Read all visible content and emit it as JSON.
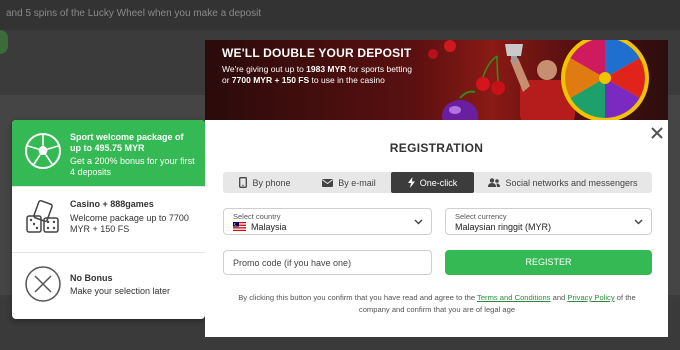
{
  "background": {
    "top_text": "and 5 spins of the Lucky Wheel when you make a deposit"
  },
  "banner": {
    "title": "WE'LL DOUBLE YOUR DEPOSIT",
    "line1_pre": "We're giving out up to ",
    "line1_amount": "1983 MYR",
    "line1_post": " for sports betting",
    "line2_pre": "or ",
    "line2_amount": "7700 MYR + 150 FS",
    "line2_post": " to use in the casino"
  },
  "bonuses": [
    {
      "title": "Sport welcome package of up to 495.75 MYR",
      "desc": "Get a 200% bonus for your first 4 deposits",
      "icon": "football-icon",
      "selected": true
    },
    {
      "title": "Casino + 888games",
      "desc": "Welcome package up to 7700 MYR + 150 FS",
      "icon": "casino-dice-icon",
      "selected": false
    },
    {
      "title": "No Bonus",
      "desc": "Make your selection later",
      "icon": "no-bonus-icon",
      "selected": false
    }
  ],
  "modal": {
    "title": "REGISTRATION",
    "tabs": [
      {
        "label": "By phone",
        "icon": "phone-icon",
        "active": false
      },
      {
        "label": "By e-mail",
        "icon": "envelope-icon",
        "active": false
      },
      {
        "label": "One-click",
        "icon": "lightning-icon",
        "active": true
      },
      {
        "label": "Social networks and messengers",
        "icon": "people-icon",
        "active": false
      }
    ],
    "country": {
      "label": "Select country",
      "value": "Malaysia"
    },
    "currency": {
      "label": "Select currency",
      "value": "Malaysian ringgit (MYR)"
    },
    "promo_placeholder": "Promo code (if you have one)",
    "register_label": "REGISTER",
    "terms_pre": "By clicking this button you confirm that you have read and agree to the ",
    "terms_link": "Terms and Conditions",
    "terms_mid": " and ",
    "privacy_link": "Privacy Policy",
    "terms_post": " of the company and confirm that you are of legal age"
  },
  "colors": {
    "accent_green": "#35b954",
    "dark_tab": "#3c3c3c",
    "banner_red": "#8a1a15"
  }
}
